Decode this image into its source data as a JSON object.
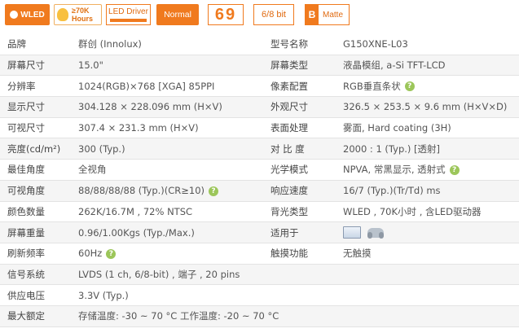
{
  "badges": {
    "wled": "WLED",
    "hours_line1": "≥70K",
    "hours_line2": "Hours",
    "led_driver": "LED Driver",
    "normal": "Normal",
    "six_nine": "69",
    "bit": "6/8 bit",
    "matte_letter": "B",
    "matte": "Matte"
  },
  "specs": {
    "r0": {
      "k1": "品牌",
      "v1": "群创 (Innolux)",
      "k2": "型号名称",
      "v2": "G150XNE-L03"
    },
    "r1": {
      "k1": "屏幕尺寸",
      "v1": "15.0\"",
      "k2": "屏幕类型",
      "v2": "液晶模组,   a-Si TFT-LCD"
    },
    "r2": {
      "k1": "分辨率",
      "v1": "1024(RGB)×768   [XGA]  85PPI",
      "k2": "像素配置",
      "v2": "RGB垂直条状"
    },
    "r3": {
      "k1": "显示尺寸",
      "v1": "304.128 × 228.096 mm (H×V)",
      "k2": "外观尺寸",
      "v2": "326.5 × 253.5 × 9.6 mm (H×V×D)"
    },
    "r4": {
      "k1": "可视尺寸",
      "v1": "307.4 × 231.3 mm (H×V)",
      "k2": "表面处理",
      "v2": "雾面, Hard coating (3H)"
    },
    "r5": {
      "k1": "亮度(cd/m²)",
      "v1": "300 (Typ.)",
      "k2": "对 比 度",
      "v2": "2000 : 1 (Typ.) [透射]"
    },
    "r6": {
      "k1": "最佳角度",
      "v1": "全视角",
      "k2": "光学模式",
      "v2": "NPVA, 常黑显示, 透射式"
    },
    "r7": {
      "k1": "可视角度",
      "v1": "88/88/88/88 (Typ.)(CR≥10)",
      "k2": "响应速度",
      "v2": "16/7 (Typ.)(Tr/Td) ms"
    },
    "r8": {
      "k1": "颜色数量",
      "v1": "262K/16.7M , 72% NTSC",
      "k2": "背光类型",
      "v2": "WLED , 70K小时 , 含LED驱动器"
    },
    "r9": {
      "k1": "屏幕重量",
      "v1": "0.96/1.00Kgs (Typ./Max.)",
      "k2": "适用于",
      "v2": ""
    },
    "r10": {
      "k1": "刷新频率",
      "v1": "60Hz",
      "k2": "触摸功能",
      "v2": "无触摸"
    },
    "r11": {
      "k1": "信号系统",
      "v1": "LVDS (1 ch, 6/8-bit) , 端子 , 20 pins"
    },
    "r12": {
      "k1": "供应电压",
      "v1": "3.3V (Typ.)"
    },
    "r13": {
      "k1": "最大额定",
      "v1": "存储温度: -30 ~ 70 °C    工作温度: -20 ~ 70 °C"
    }
  },
  "help_glyph": "?",
  "icons": {
    "laptop": "laptop-icon",
    "gamepad": "gamepad-icon",
    "help": "help-icon"
  },
  "colors": {
    "accent": "#f07a1e",
    "help": "#9cc65a",
    "row_alt": "#f5f5f5"
  }
}
